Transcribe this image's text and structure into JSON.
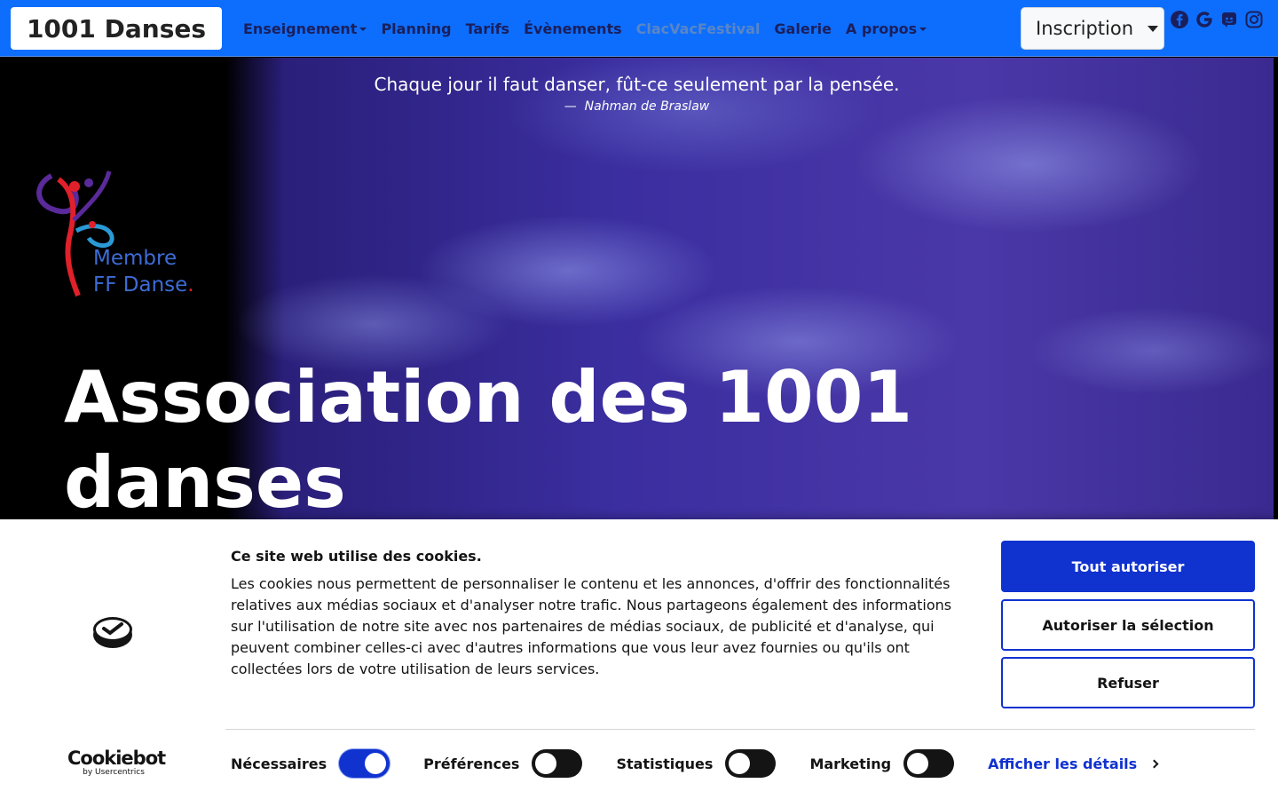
{
  "navbar": {
    "brand": "1001 Danses",
    "links": [
      {
        "label": "Enseignement",
        "dropdown": true
      },
      {
        "label": "Planning"
      },
      {
        "label": "Tarifs"
      },
      {
        "label": "Évènements"
      },
      {
        "label": "ClacVacFestival",
        "muted": true
      },
      {
        "label": "Galerie"
      },
      {
        "label": "A propos",
        "dropdown": true
      }
    ],
    "inscription": "Inscription",
    "socials": [
      "facebook-icon",
      "google-icon",
      "discord-icon",
      "instagram-icon"
    ],
    "color": "#0d6efd"
  },
  "hero": {
    "quote": "Chaque jour il faut danser, fût-ce seulement par la pensée.",
    "author": "Nahman de Braslaw",
    "author_prefix": "—",
    "badge_line1": "Membre",
    "badge_line2": "FF Danse",
    "badge_dot": ".",
    "title": "Association des 1001 danses"
  },
  "cookie": {
    "title": "Ce site web utilise des cookies.",
    "body": "Les cookies nous permettent de personnaliser le contenu et les annonces, d'offrir des fonctionnalités relatives aux médias sociaux et d'analyser notre trafic. Nous partageons également des informations sur l'utilisation de notre site avec nos partenaires de médias sociaux, de publicité et d'analyse, qui peuvent combiner celles-ci avec d'autres informations que vous leur avez fournies ou qu'ils ont collectées lors de votre utilisation de leurs services.",
    "buttons": {
      "allow_all": "Tout autoriser",
      "allow_selection": "Autoriser la sélection",
      "refuse": "Refuser"
    },
    "toggles": [
      {
        "label": "Nécessaires",
        "on": true
      },
      {
        "label": "Préférences",
        "on": false
      },
      {
        "label": "Statistiques",
        "on": false
      },
      {
        "label": "Marketing",
        "on": false
      }
    ],
    "details": "Afficher les détails",
    "brand_main": "Cookiebot",
    "brand_sub": "by Usercentrics",
    "accent": "#1032cf"
  }
}
